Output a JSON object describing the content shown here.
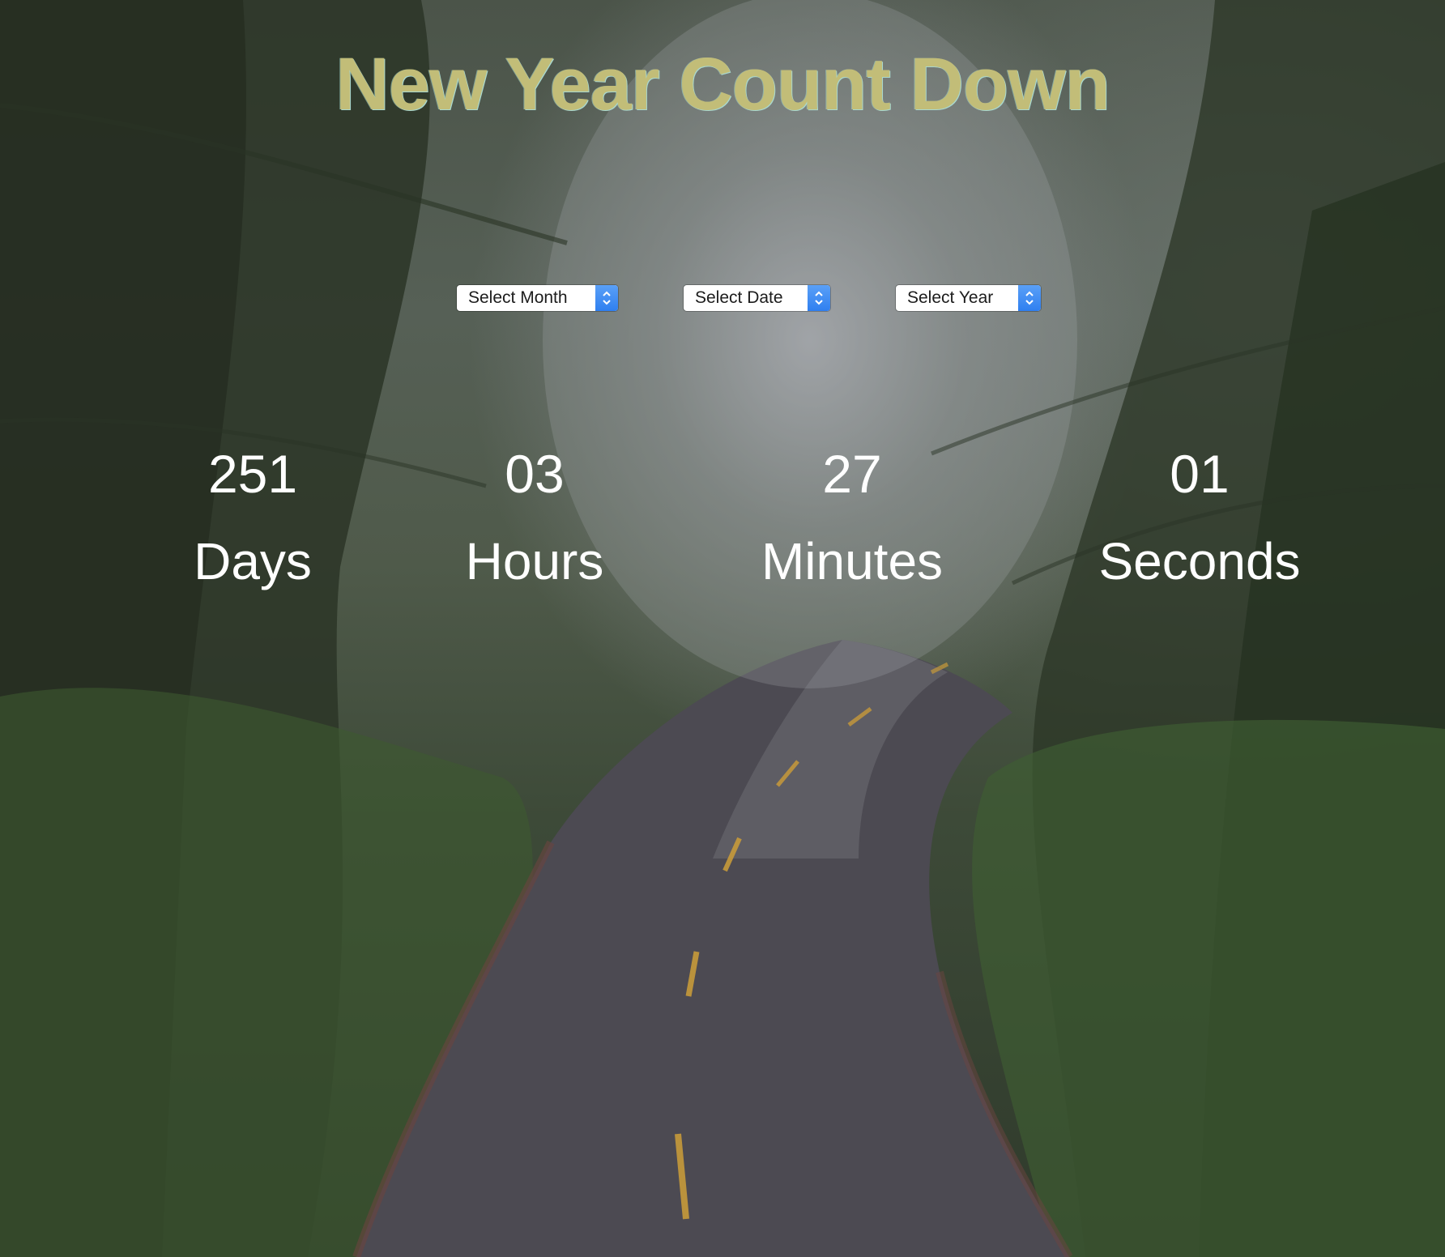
{
  "title": "New Year Count Down",
  "selects": {
    "month": "Select Month",
    "date": "Select Date",
    "year": "Select Year"
  },
  "countdown": {
    "days": {
      "value": "251",
      "label": "Days"
    },
    "hours": {
      "value": "03",
      "label": "Hours"
    },
    "minutes": {
      "value": "27",
      "label": "Minutes"
    },
    "seconds": {
      "value": "01",
      "label": "Seconds"
    }
  },
  "colors": {
    "title": "#c2bd78",
    "text": "#ffffff",
    "select_accent": "#2f7ff0"
  },
  "icons": {
    "select_stepper": "chevron-up-down-icon"
  }
}
